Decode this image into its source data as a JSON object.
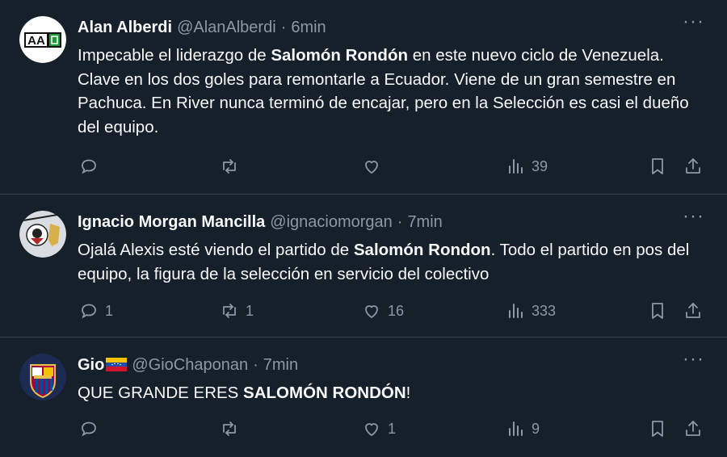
{
  "tweets": [
    {
      "name": "Alan Alberdi",
      "handle": "@AlanAlberdi",
      "time": "6min",
      "text_parts": [
        "Impecable el liderazgo de ",
        "Salomón Rondón",
        " en este nuevo ciclo de Venezuela. Clave en los dos goles para remontarle a Ecuador. Viene de un gran semestre en Pachuca. En River nunca terminó de encajar, pero en la Selección es casi el dueño del equipo."
      ],
      "avatar_text": "AA",
      "replies": "",
      "retweets": "",
      "likes": "",
      "views": "39"
    },
    {
      "name": "Ignacio Morgan Mancilla",
      "handle": "@ignaciomorgan",
      "time": "7min",
      "text_parts": [
        "Ojalá Alexis esté viendo el partido de ",
        "Salomón Rondon",
        ". Todo el partido en pos del equipo, la figura de la selección en servicio del colectivo"
      ],
      "replies": "1",
      "retweets": "1",
      "likes": "16",
      "views": "333"
    },
    {
      "name": "Gio",
      "handle": "@GioChaponan",
      "time": "7min",
      "text_parts": [
        "QUE GRANDE ERES ",
        "SALOMÓN RONDÓN",
        "!"
      ],
      "replies": "",
      "retweets": "",
      "likes": "1",
      "views": "9"
    }
  ],
  "dot": "·",
  "more_label": "···",
  "icons": [
    "reply-icon",
    "retweet-icon",
    "like-icon",
    "views-icon",
    "bookmark-icon",
    "share-icon"
  ],
  "colors": {
    "background": "#15202b",
    "muted": "#8b98a5",
    "divider": "#38444d",
    "text": "#f7f9f9"
  }
}
